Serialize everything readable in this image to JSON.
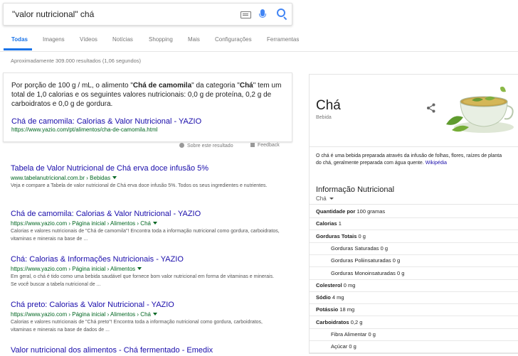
{
  "search": {
    "query": "\"valor nutricional\" chá"
  },
  "tabs": [
    {
      "label": "Todas",
      "active": true
    },
    {
      "label": "Imagens"
    },
    {
      "label": "Vídeos"
    },
    {
      "label": "Notícias"
    },
    {
      "label": "Shopping"
    },
    {
      "label": "Mais"
    },
    {
      "label": "Configurações"
    },
    {
      "label": "Ferramentas"
    }
  ],
  "stats": "Aproximadamente 309.000 resultados (1,06 segundos)",
  "featured": {
    "pre": "Por porção de 100 g / mL, o alimento \"",
    "b1": "Chá de camomila",
    "mid": "\" da categoria \"",
    "b2": "Chá",
    "post": "\" tem um total de 1,0 calorias e os seguintes valores nutricionais: 0,0 g de proteína, 0,2 g de carboidratos e 0,0 g de gordura.",
    "title": "Chá de camomila: Calorias & Valor Nutricional - YAZIO",
    "url": "https://www.yazio.com/pt/alimentos/cha-de-camomila.html",
    "about": "Sobre este resultado",
    "feedback": "Feedback"
  },
  "results": [
    {
      "title": "Tabela de Valor Nutricional de Chá erva doce infusão 5%",
      "url": "www.tabelanutricional.com.br › Bebidas",
      "snippet": "Veja e compare a Tabela de valor nutricional de Chá erva doce infusão 5%. Todos os seus ingredientes e nutrientes."
    },
    {
      "title": "Chá de camomila: Calorias & Valor Nutricional - YAZIO",
      "url": "https://www.yazio.com › Página inicial › Alimentos › Chá",
      "snippet": "Calorias e valores nutricionais de \"Chá de camomila\"! Encontra toda a informação nutricional como gordura, carboidratos, vitaminas e minerais na base de ..."
    },
    {
      "title": "Chá: Calorias & Informações Nutricionais - YAZIO",
      "url": "https://www.yazio.com › Página inicial › Alimentos",
      "snippet": "Em geral, o chá é tido como uma bebida saudável que fornece bom valor nutricional em forma de vitaminas e minerais. Se você buscar a tabela nutricional de ..."
    },
    {
      "title": "Chá preto: Calorias & Valor Nutricional - YAZIO",
      "url": "https://www.yazio.com › Página inicial › Alimentos › Chá",
      "snippet": "Calorias e valores nutricionais de \"Chá preto\"! Encontra toda a informação nutricional como gordura, carboidratos, vitaminas e minerais na base de dados de ..."
    },
    {
      "title": "Valor nutricional dos alimentos - Chá fermentado - Emedix",
      "url": "",
      "snippet": ""
    }
  ],
  "knowledge_panel": {
    "title": "Chá",
    "subtitle": "Bebida",
    "description": "O chá é uma bebida preparada através da infusão de folhas, flores, raízes de planta do chá, geralmente preparada com água quente.",
    "wiki": "Wikipédia",
    "info_title": "Informação Nutricional",
    "select": "Chá",
    "rows": [
      {
        "label": "Quantidade por",
        "value": "100 gramas",
        "indent": false
      },
      {
        "label": "Calorias",
        "value": "1",
        "indent": false
      },
      {
        "label": "Gorduras Totais",
        "value": "0 g",
        "indent": false
      },
      {
        "label": "Gorduras Saturadas",
        "value": "0 g",
        "indent": true
      },
      {
        "label": "Gorduras Poliinsaturadas",
        "value": "0 g",
        "indent": true
      },
      {
        "label": "Gorduras Monoinsaturadas",
        "value": "0 g",
        "indent": true
      },
      {
        "label": "Colesterol",
        "value": "0 mg",
        "indent": false
      },
      {
        "label": "Sódio",
        "value": "4 mg",
        "indent": false
      },
      {
        "label": "Potássio",
        "value": "18 mg",
        "indent": false
      },
      {
        "label": "Carboidratos",
        "value": "0,2 g",
        "indent": false
      },
      {
        "label": "Fibra Alimentar",
        "value": "0 g",
        "indent": true
      },
      {
        "label": "Açúcar",
        "value": "0 g",
        "indent": true
      }
    ]
  },
  "colors": {
    "link": "#1a0dab",
    "url": "#006621",
    "accent": "#1a73e8"
  }
}
